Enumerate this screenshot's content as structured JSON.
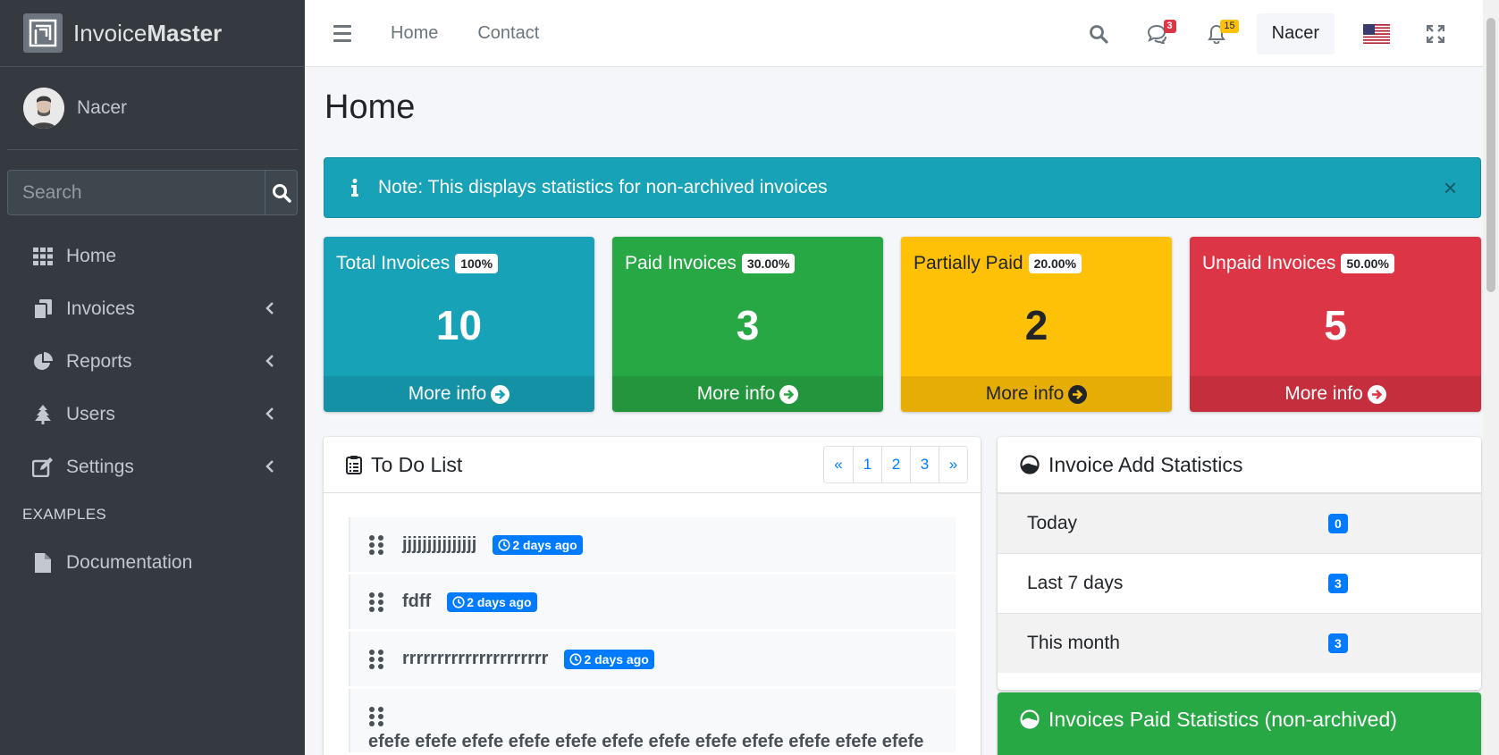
{
  "app": {
    "brand_light": "Invoice",
    "brand_bold": "Master",
    "user_name": "Nacer"
  },
  "sidebar": {
    "search_placeholder": "Search",
    "items": [
      {
        "label": "Home",
        "icon": "grid-icon"
      },
      {
        "label": "Invoices",
        "icon": "copy-icon"
      },
      {
        "label": "Reports",
        "icon": "pie-chart-icon"
      },
      {
        "label": "Users",
        "icon": "tree-icon"
      },
      {
        "label": "Settings",
        "icon": "edit-icon"
      }
    ],
    "header": "EXAMPLES",
    "doc_label": "Documentation"
  },
  "topnav": {
    "links": [
      "Home",
      "Contact"
    ],
    "messages_count": "3",
    "notifications_count": "15",
    "user": "Nacer"
  },
  "page": {
    "title": "Home"
  },
  "alert": {
    "text": "Note: This displays statistics for non-archived invoices",
    "close": "×"
  },
  "boxes": [
    {
      "title": "Total Invoices",
      "pct": "100%",
      "value": "10",
      "footer": "More info",
      "color": "#17a2b8"
    },
    {
      "title": "Paid Invoices",
      "pct": "30.00%",
      "value": "3",
      "footer": "More info",
      "color": "#28a745"
    },
    {
      "title": "Partially Paid",
      "pct": "20.00%",
      "value": "2",
      "footer": "More info",
      "color": "#ffc107"
    },
    {
      "title": "Unpaid Invoices",
      "pct": "50.00%",
      "value": "5",
      "footer": "More info",
      "color": "#dc3545"
    }
  ],
  "todo": {
    "title": "To Do List",
    "pager": [
      "«",
      "1",
      "2",
      "3",
      "»"
    ],
    "items": [
      {
        "text": "jjjjjjjjjjjjjjj",
        "badge": "2 days ago"
      },
      {
        "text": "fdff",
        "badge": "2 days ago"
      },
      {
        "text": "rrrrrrrrrrrrrrrrrrrrr",
        "badge": "2 days ago"
      },
      {
        "text": "efefe efefe efefe efefe efefe efefe efefe efefe efefe efefe efefe efefe"
      }
    ]
  },
  "stats": {
    "title": "Invoice Add Statistics",
    "rows": [
      {
        "label": "Today",
        "value": "0"
      },
      {
        "label": "Last 7 days",
        "value": "3"
      },
      {
        "label": "This month",
        "value": "3"
      }
    ]
  },
  "paid_stats": {
    "title": "Invoices Paid Statistics (non-archived)"
  }
}
